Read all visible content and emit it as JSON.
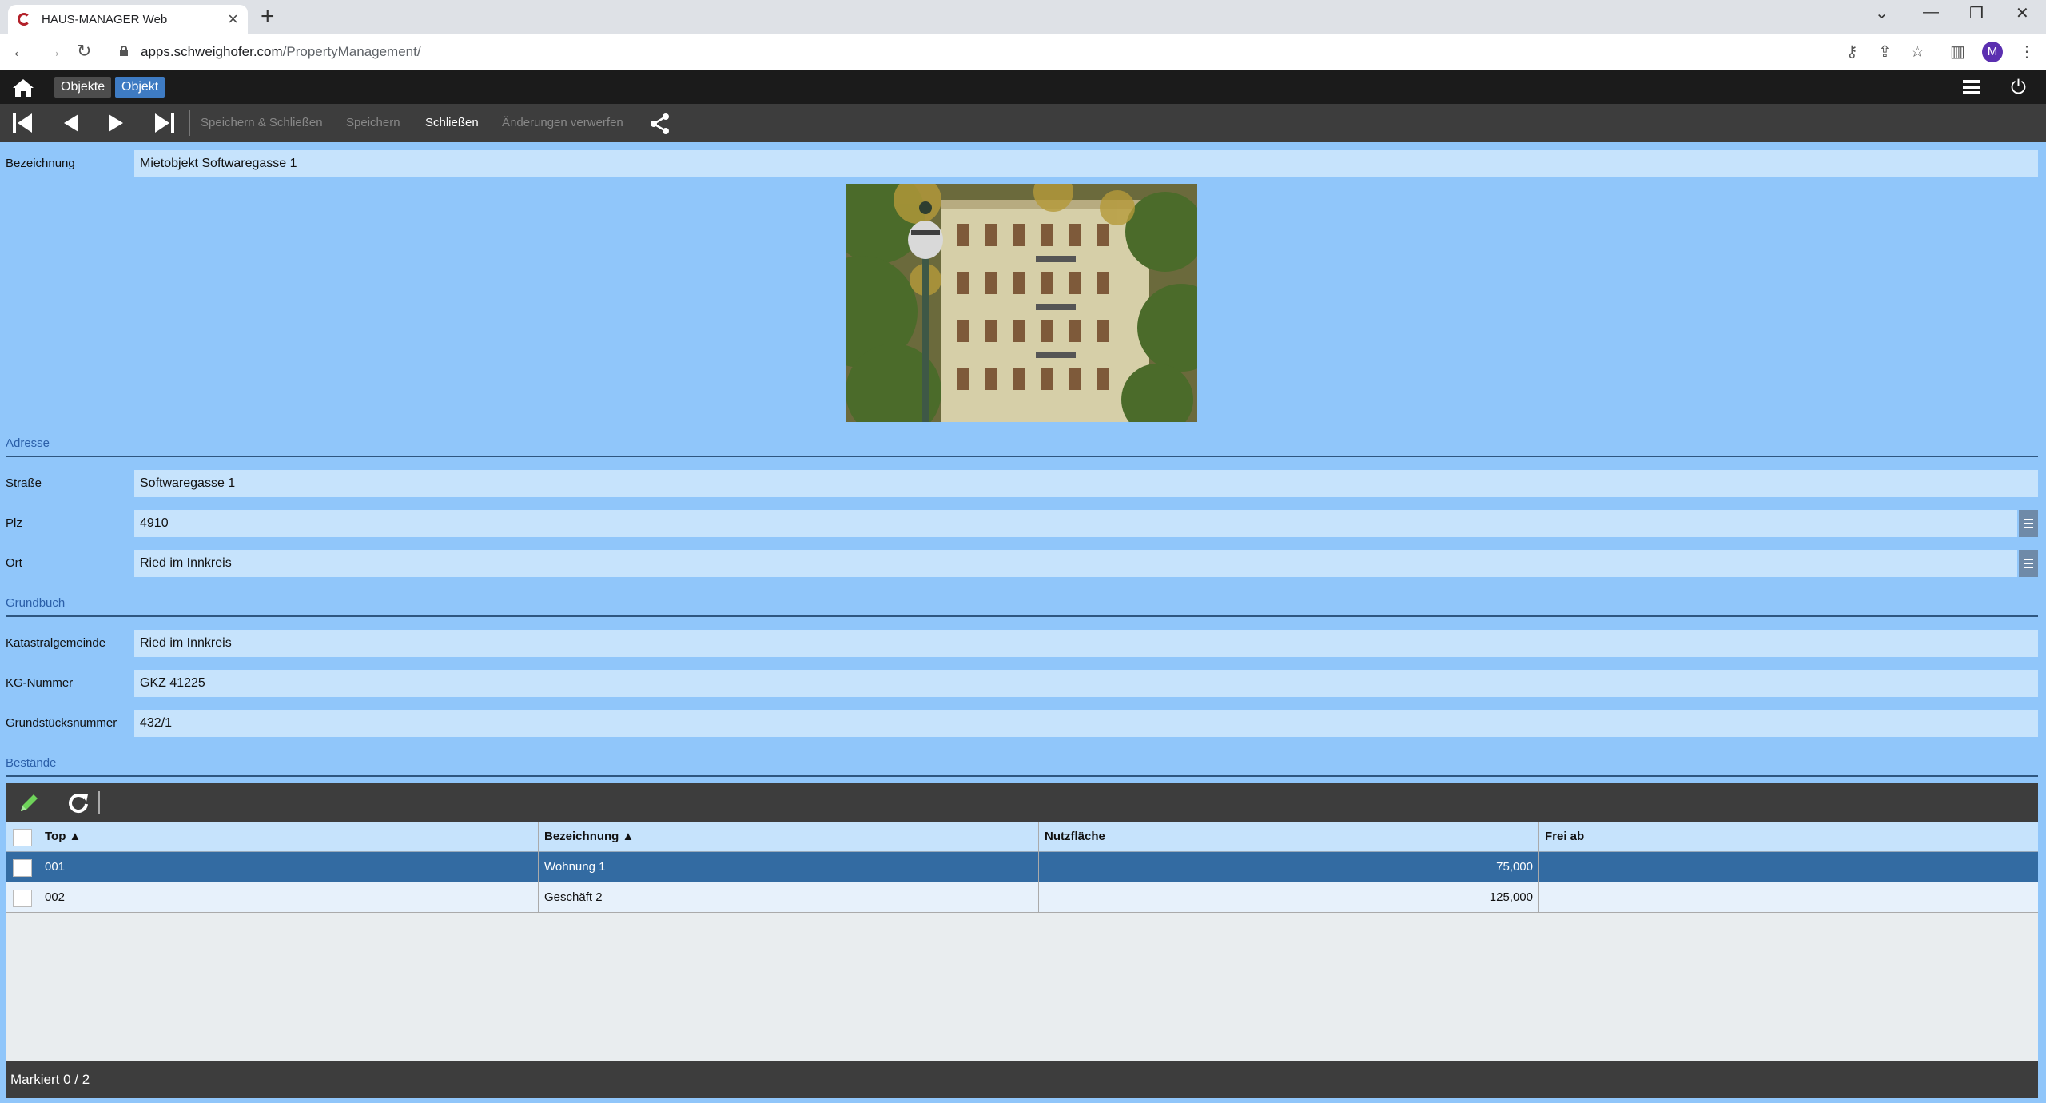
{
  "browser": {
    "tab_title": "HAUS-MANAGER Web",
    "url_host": "apps.schweighofer.com",
    "url_path": "/PropertyManagement/",
    "avatar_letter": "M"
  },
  "header": {
    "breadcrumbs": [
      "Objekte",
      "Objekt"
    ]
  },
  "toolbar": {
    "save_close": "Speichern & Schließen",
    "save": "Speichern",
    "close": "Schließen",
    "discard": "Änderungen verwerfen"
  },
  "form": {
    "bezeichnung": {
      "label": "Bezeichnung",
      "value": "Mietobjekt Softwaregasse 1"
    },
    "section_adresse": "Adresse",
    "strasse": {
      "label": "Straße",
      "value": "Softwaregasse 1"
    },
    "plz": {
      "label": "Plz",
      "value": "4910"
    },
    "ort": {
      "label": "Ort",
      "value": "Ried im Innkreis"
    },
    "section_grundbuch": "Grundbuch",
    "katastralgemeinde": {
      "label": "Katastralgemeinde",
      "value": "Ried im Innkreis"
    },
    "kg_nummer": {
      "label": "KG-Nummer",
      "value": "GKZ 41225"
    },
    "grundstuecksnummer": {
      "label": "Grundstücksnummer",
      "value": "432/1"
    },
    "section_bestaende": "Bestände"
  },
  "grid": {
    "columns": [
      "Top ▲",
      "Bezeichnung ▲",
      "Nutzfläche",
      "Frei ab"
    ],
    "rows": [
      {
        "top": "001",
        "bezeichnung": "Wohnung 1",
        "nutzflaeche": "75,000",
        "frei_ab": "",
        "selected": true
      },
      {
        "top": "002",
        "bezeichnung": "Geschäft 2",
        "nutzflaeche": "125,000",
        "frei_ab": "",
        "selected": false
      }
    ],
    "footer": "Markiert 0 / 2"
  },
  "colors": {
    "background": "#90c6fa",
    "field": "#c6e3fc",
    "selected_row": "#336ba2",
    "dark_bar": "#3d3d3d",
    "section_text": "#2b5fa8",
    "edit_icon": "#6fd35a"
  }
}
